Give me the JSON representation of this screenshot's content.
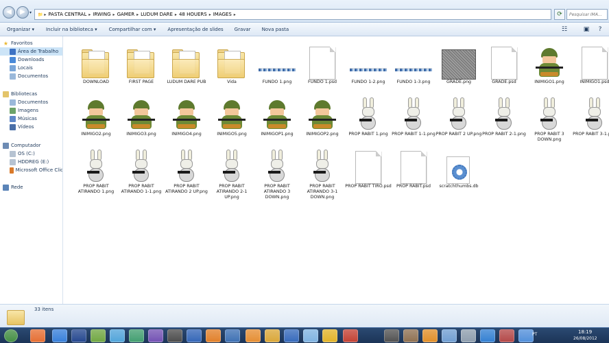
{
  "address": {
    "crumbs": [
      "PASTA CENTRAL",
      "IRWING",
      "GAMER",
      "LUDUM DARE",
      "48 HOUERS",
      "IMAGES"
    ],
    "search_placeholder": "Pesquisar IMA..."
  },
  "toolbar": {
    "items": [
      "Organizar ▾",
      "Incluir na biblioteca ▾",
      "Compartilhar com ▾",
      "Apresentação de slides",
      "Gravar",
      "Nova pasta"
    ]
  },
  "nav": {
    "favorites_header": "Favoritos",
    "favorites": [
      "Área de Trabalho",
      "Downloads",
      "Locais",
      "Documentos"
    ],
    "libraries_header": "Bibliotecas",
    "libraries": [
      "Documentos",
      "Imagens",
      "Músicas",
      "Vídeos"
    ],
    "computer_header": "Computador",
    "computer": [
      "OS (C:)",
      "HDDREG (E:)",
      "Microsoft Office Clic"
    ],
    "network_header": "Rede"
  },
  "files": [
    {
      "name": "DOWNLOAD",
      "kind": "folder"
    },
    {
      "name": "FIRST PAGE",
      "kind": "folder"
    },
    {
      "name": "LUDUM DARE PUB",
      "kind": "folder"
    },
    {
      "name": "Vida",
      "kind": "folder"
    },
    {
      "name": "FUNDO 1.png",
      "kind": "strip"
    },
    {
      "name": "FUNDO 1.psd",
      "kind": "doc"
    },
    {
      "name": "FUNDO 1-2.png",
      "kind": "strip"
    },
    {
      "name": "FUNDO 1-3.png",
      "kind": "strip"
    },
    {
      "name": "GRADE.png",
      "kind": "noise"
    },
    {
      "name": "GRADE.psd",
      "kind": "doc"
    },
    {
      "name": "INIMIGO1.png",
      "kind": "soldier"
    },
    {
      "name": "INIMIGO1.psd",
      "kind": "doc"
    },
    {
      "name": "INIMIGO2.png",
      "kind": "soldier"
    },
    {
      "name": "INIMIGO3.png",
      "kind": "soldier"
    },
    {
      "name": "INIMIGO4.png",
      "kind": "soldier"
    },
    {
      "name": "INIMIGO5.png",
      "kind": "soldier"
    },
    {
      "name": "INIMIGOP1.png",
      "kind": "soldier"
    },
    {
      "name": "INIMIGOP2.png",
      "kind": "soldier"
    },
    {
      "name": "PROP RABIT 1.png",
      "kind": "rabbit"
    },
    {
      "name": "PROP RABIT 1-1.png",
      "kind": "rabbit"
    },
    {
      "name": "PROP RABIT 2 UP.png",
      "kind": "rabbit"
    },
    {
      "name": "PROP RABIT 2-1.png",
      "kind": "rabbit"
    },
    {
      "name": "PROP RABIT 3 DOWN.png",
      "kind": "rabbit"
    },
    {
      "name": "PROP RABIT 3-1.png",
      "kind": "rabbit"
    },
    {
      "name": "PROP RABIT ATIRANDO 1.png",
      "kind": "rabbit"
    },
    {
      "name": "PROP RABIT ATIRANDO 1-1.png",
      "kind": "rabbit"
    },
    {
      "name": "PROP RABIT ATIRANDO 2 UP.png",
      "kind": "rabbit"
    },
    {
      "name": "PROP RABIT ATIRANDO 2-1 UP.png",
      "kind": "rabbit"
    },
    {
      "name": "PROP RABIT ATIRANDO 3 DOWN.png",
      "kind": "rabbit"
    },
    {
      "name": "PROP RABIT ATIRANDO 3-1 DOWN.png",
      "kind": "rabbit"
    },
    {
      "name": "PROP RABIT TIRO.psd",
      "kind": "doc"
    },
    {
      "name": "PROP RABIT.psd",
      "kind": "doc"
    },
    {
      "name": "scratchthumbs.db",
      "kind": "gear"
    }
  ],
  "details": {
    "count": "33 itens"
  },
  "taskbar": {
    "apps": [
      "start-orb",
      "firefox",
      "ie",
      "photoshop",
      "green-app",
      "chrome-app",
      "image-app",
      "wireless-app",
      "unity",
      "word",
      "blender",
      "digital-app",
      "scratch",
      "explorer",
      "window-app",
      "media",
      "chrome",
      "opera-app",
      "calendar",
      "gimp",
      "cat-app",
      "arrow-app",
      "tool-app",
      "download",
      "game-app",
      "net-app"
    ],
    "lang": "PT",
    "time": "18:19",
    "date": "26/08/2012"
  }
}
